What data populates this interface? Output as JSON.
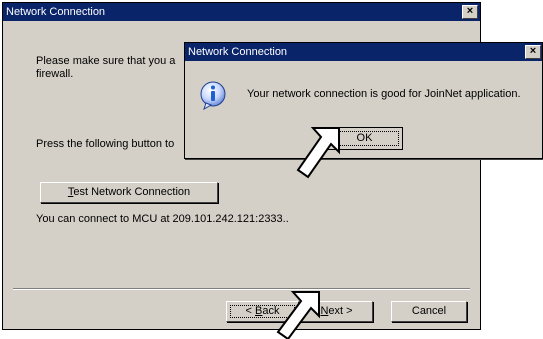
{
  "main_dialog": {
    "title": "Network Connection",
    "instruction_line1": "Please make sure that you a",
    "instruction_line2": "firewall.",
    "press_text": "Press the following button to",
    "test_button": "Test Network Connection",
    "test_button_mnemonic": "T",
    "test_button_rest": "est Network Connection",
    "result_text": "You can connect to MCU at 209.101.242.121:2333..",
    "back_button": "< Back",
    "back_prefix": "< ",
    "back_mnemonic": "B",
    "back_rest": "ack",
    "next_button": "Next >",
    "next_mnemonic": "N",
    "next_rest": "ext >",
    "cancel_button": "Cancel"
  },
  "popup_dialog": {
    "title": "Network Connection",
    "message": "Your network connection is good for JoinNet application.",
    "ok_button": "OK",
    "icon": "info-icon"
  },
  "close_glyph": "×",
  "icons": [
    "close-icon",
    "info-icon",
    "pointer-cursor-icon"
  ],
  "colors": {
    "titlebar": "#0a246a",
    "face": "#d4d0c8",
    "info_blue": "#1f5fcf"
  }
}
